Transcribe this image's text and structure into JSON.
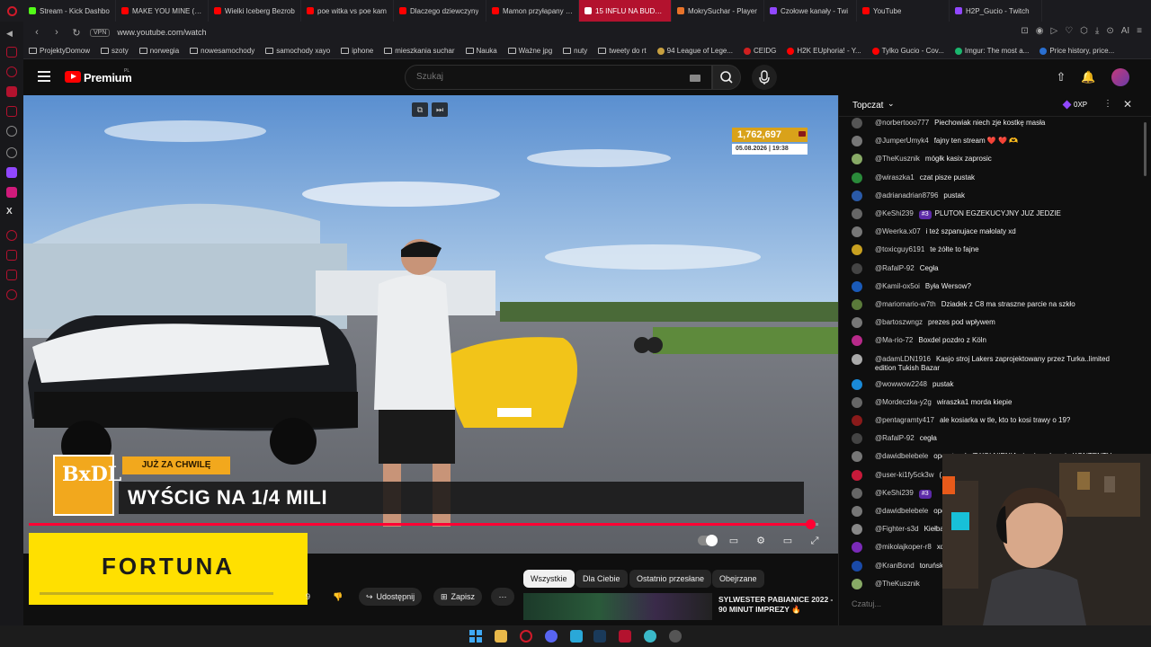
{
  "tabs": [
    {
      "label": "Stream - Kick Dashbo",
      "color": "#53fc18"
    },
    {
      "label": "MAKE YOU MINE (HA",
      "color": "#ff0000"
    },
    {
      "label": "Wielki Iceberg Bezrob",
      "color": "#ff0000"
    },
    {
      "label": "poe witka vs poe kam",
      "color": "#ff0000"
    },
    {
      "label": "Dlaczego dziewczyny",
      "color": "#ff0000"
    },
    {
      "label": "Mamon przyłapany na",
      "color": "#ff0000"
    },
    {
      "label": "15 INFLU NA BUDOWIE",
      "color": "#ffffff",
      "active": true
    },
    {
      "label": "MokrySuchar - Player",
      "color": "#e8732a"
    },
    {
      "label": "Czołowe kanały - Twi",
      "color": "#9147ff"
    },
    {
      "label": "YouTube",
      "color": "#ff0000"
    },
    {
      "label": "H2P_Gucio - Twitch",
      "color": "#9147ff"
    }
  ],
  "address_bar": {
    "vpn": "VPN",
    "url": "www.youtube.com/watch"
  },
  "bookmarks": [
    {
      "label": "ProjektyDomow",
      "type": "folder"
    },
    {
      "label": "szoty",
      "type": "folder"
    },
    {
      "label": "norwegia",
      "type": "folder"
    },
    {
      "label": "nowesamochody",
      "type": "folder"
    },
    {
      "label": "samochody xayo",
      "type": "folder"
    },
    {
      "label": "iphone",
      "type": "folder"
    },
    {
      "label": "mieszkania suchar",
      "type": "folder"
    },
    {
      "label": "Nauka",
      "type": "folder"
    },
    {
      "label": "Ważne jpg",
      "type": "folder"
    },
    {
      "label": "nuty",
      "type": "folder"
    },
    {
      "label": "tweety do rt",
      "type": "folder"
    },
    {
      "label": "94 League of Lege...",
      "type": "site",
      "color": "#c8a040"
    },
    {
      "label": "CEIDG",
      "type": "site",
      "color": "#d02020"
    },
    {
      "label": "H2K EUphoria! - Y...",
      "type": "site",
      "color": "#ff0000"
    },
    {
      "label": "Tylko Gucio - Cov...",
      "type": "site",
      "color": "#ff0000"
    },
    {
      "label": "Imgur: The most a...",
      "type": "site",
      "color": "#1bb76e"
    },
    {
      "label": "Price history, price...",
      "type": "site",
      "color": "#2a6fd0"
    }
  ],
  "youtube": {
    "brand": "Premium",
    "region": "PL",
    "search_placeholder": "Szukaj"
  },
  "video": {
    "counter_value": "1,762,697",
    "counter_date": "05.08.2026 | 19:38",
    "banner_logo": "BxDL",
    "banner_soon": "JUŻ ZA CHWILĘ",
    "banner_title": "WYŚCIG NA 1/4 MILI",
    "progress": 0.99
  },
  "ad": {
    "brand": "FORTUNA"
  },
  "actions": {
    "likes_partial": "9",
    "share": "Udostępnij",
    "save": "Zapisz"
  },
  "chips": [
    {
      "label": "Wszystkie",
      "active": true
    },
    {
      "label": "Dla Ciebie"
    },
    {
      "label": "Ostatnio przesłane"
    },
    {
      "label": "Obejrzane"
    }
  ],
  "recommendation": {
    "title": "SYLWESTER PABIANICE 2022 - 90 MINUT IMPREZY 🔥"
  },
  "chat": {
    "title": "Topczat",
    "xp": "0XP",
    "input_placeholder": "Czatuj...",
    "messages": [
      {
        "user": "@norbertooo777",
        "text": "Piechowiak niech zje kostkę masła",
        "color": "#555"
      },
      {
        "user": "@JumperUmyk4",
        "text": "fajny ten stream ❤️ ❤️ 🫶",
        "color": "#777"
      },
      {
        "user": "@TheKusznik",
        "text": "mógłk kasix zaprosic",
        "color": "#8a6"
      },
      {
        "user": "@wiraszka1",
        "text": "czat pisze pustak",
        "color": "#2a8a3a"
      },
      {
        "user": "@adrianadrian8796",
        "text": "pustak",
        "color": "#2a5aa8"
      },
      {
        "user": "@KeShi239",
        "text": "PLUTON EGZEKUCYJNY JUZ JEDZIE",
        "badge": "#3",
        "color": "#666"
      },
      {
        "user": "@Weerka.x07",
        "text": "i też szpanujace małolaty xd",
        "color": "#777"
      },
      {
        "user": "@toxicguy6191",
        "text": "te żółte to fajne",
        "color": "#c8a020"
      },
      {
        "user": "@RafalP-92",
        "text": "Cegła",
        "color": "#444"
      },
      {
        "user": "@Kamil-ox5oi",
        "text": "Była Wersow?",
        "color": "#1a5ab8"
      },
      {
        "user": "@mariomario-w7th",
        "text": "Dziadek z C8 ma straszne parcie na szkło",
        "color": "#5a7a3a"
      },
      {
        "user": "@bartoszwngz",
        "text": "prezes pod wpływem",
        "color": "#777"
      },
      {
        "user": "@Ma-rio-72",
        "text": "Boxdel pozdro z Köln",
        "color": "#b82a8a"
      },
      {
        "user": "@adamLDN1916",
        "text": "Kasjo stroj Lakers zaprojektowany przez Turka..limited",
        "text2": "edition Tukish Bazar",
        "color": "#aaa"
      },
      {
        "user": "@wowwow2248",
        "text": "pustak",
        "color": "#1a8ad8"
      },
      {
        "user": "@Mordeczka-y2g",
        "text": "wiraszka1 morda kiepie",
        "color": "#666"
      },
      {
        "user": "@pentagramty417",
        "text": "ale kosiarka w tle, kto to kosi trawy o 19?",
        "color": "#8a1a1a"
      },
      {
        "user": "@RafalP-92",
        "text": "cegła",
        "color": "#444"
      },
      {
        "user": "@dawidbelebele",
        "text": "operator do ZWOLNIENIA nic nie pokazuje KONTENTU",
        "color": "#777"
      },
      {
        "user": "@user-ki1fy5ck3w",
        "text": "(",
        "color": "#c81a3a"
      },
      {
        "user": "@KeShi239",
        "text": "",
        "badge": "#3",
        "color": "#666"
      },
      {
        "user": "@dawidbelebele",
        "text": "ope",
        "color": "#777"
      },
      {
        "user": "@Fighter-s3d",
        "text": "Kiełba",
        "color": "#888"
      },
      {
        "user": "@mikolajkoper-r8",
        "text": "xd",
        "color": "#7a2ab8"
      },
      {
        "user": "@KranBond",
        "text": "toruńsk",
        "color": "#1a4aa8"
      },
      {
        "user": "@TheKusznik",
        "text": "",
        "color": "#8a6"
      }
    ]
  },
  "colors": {
    "accent": "#ff0033",
    "banner": "#f2a81d",
    "ad": "#ffe000",
    "twitch": "#9147ff"
  }
}
